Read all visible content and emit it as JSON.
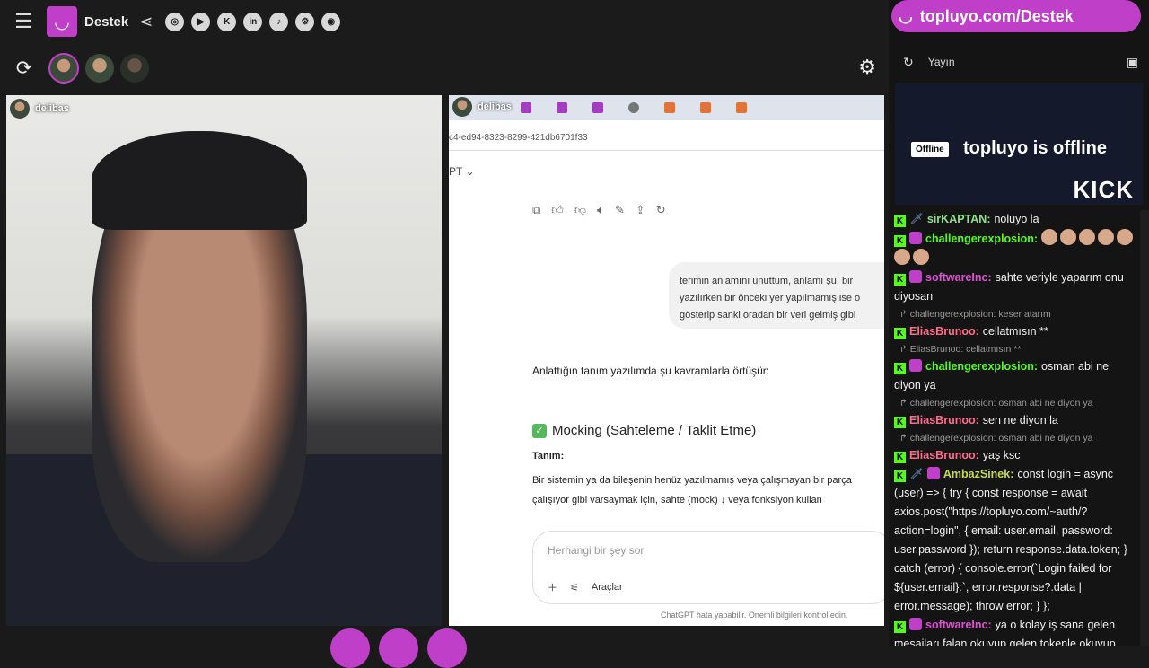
{
  "header": {
    "brand": "Destek",
    "socials": [
      "instagram-icon",
      "youtube-icon",
      "kick-icon",
      "linkedin-icon",
      "tiktok-icon",
      "steam-icon",
      "github-icon"
    ]
  },
  "promo": {
    "text": "topluyo.com/Destek"
  },
  "streams": {
    "cam_user": "delibas",
    "screen_user": "delibas"
  },
  "screen": {
    "url": "c4-ed94-8323-8299-421db6701f33",
    "model": "PT",
    "user_bubble": "terimin anlamını unuttum, anlamı şu, bir yazılırken bir önceki yer yapılmamış ise o gösterip sanki oradan bir veri gelmiş gibi",
    "intro": "Anlattığın tanım yazılımda şu kavramlarla örtüşür:",
    "heading": "Mocking (Sahteleme / Taklit Etme)",
    "tanim_label": "Tanım:",
    "para_line1": "Bir sistemin ya da bileşenin henüz yazılmamış veya çalışmayan bir parça",
    "para_line2": "çalışıyor gibi varsaymak için, sahte (mock) ↓ veya fonksiyon kullan",
    "input_placeholder": "Herhangi bir şey sor",
    "tools_label": "Araçlar",
    "footnote": "ChatGPT hata yapabilir. Önemli bilgileri kontrol edin."
  },
  "side": {
    "yayin_label": "Yayın",
    "offline_badge": "Offline",
    "offline_text": "topluyo is offline",
    "kick_logo": "KICK"
  },
  "chat": [
    {
      "user": "sirKAPTAN:",
      "color": "#8fe08a",
      "badges": [
        "k",
        "sword"
      ],
      "text": "noluyo la"
    },
    {
      "user": "challengerexplosion:",
      "color": "#53fc18",
      "badges": [
        "k",
        "sub"
      ],
      "text": "",
      "emojis": 7
    },
    {
      "user": "softwareInc:",
      "color": "#e04fd6",
      "badges": [
        "k",
        "sub"
      ],
      "text": "sahte veriyle yaparım onu diyosan",
      "reply": "challengerexplosion: keser atarım"
    },
    {
      "user": "EliasBrunoo:",
      "color": "#ff6b8a",
      "badges": [
        "k"
      ],
      "text": "cellatmısın **",
      "reply": "EliasBrunoo: cellatmısın **"
    },
    {
      "user": "challengerexplosion:",
      "color": "#53fc18",
      "badges": [
        "k",
        "sub"
      ],
      "text": "osman abi ne diyon ya",
      "reply": "challengerexplosion: osman abi ne diyon ya"
    },
    {
      "user": "EliasBrunoo:",
      "color": "#ff6b8a",
      "badges": [
        "k"
      ],
      "text": "sen ne diyon la",
      "reply": "challengerexplosion: osman abi ne diyon ya"
    },
    {
      "user": "EliasBrunoo:",
      "color": "#ff6b8a",
      "badges": [
        "k"
      ],
      "text": "yaş ksc"
    },
    {
      "user": "AmbazSinek:",
      "color": "#c7d94a",
      "badges": [
        "k",
        "sword",
        "sub"
      ],
      "text": "const login = async (user) => { try { const response = await axios.post(\"https://topluyo.com/~auth/?action=login\", { email: user.email, password: user.password }); return response.data.token; } catch (error) { console.error(`Login failed for ${user.email}:`, error.response?.data || error.message); throw error; } };"
    },
    {
      "user": "softwareInc:",
      "color": "#e04fd6",
      "badges": [
        "k",
        "sub"
      ],
      "text": "ya o kolay iş sana gelen mesajları falan okuyup gelen tokenle okuyup"
    }
  ]
}
